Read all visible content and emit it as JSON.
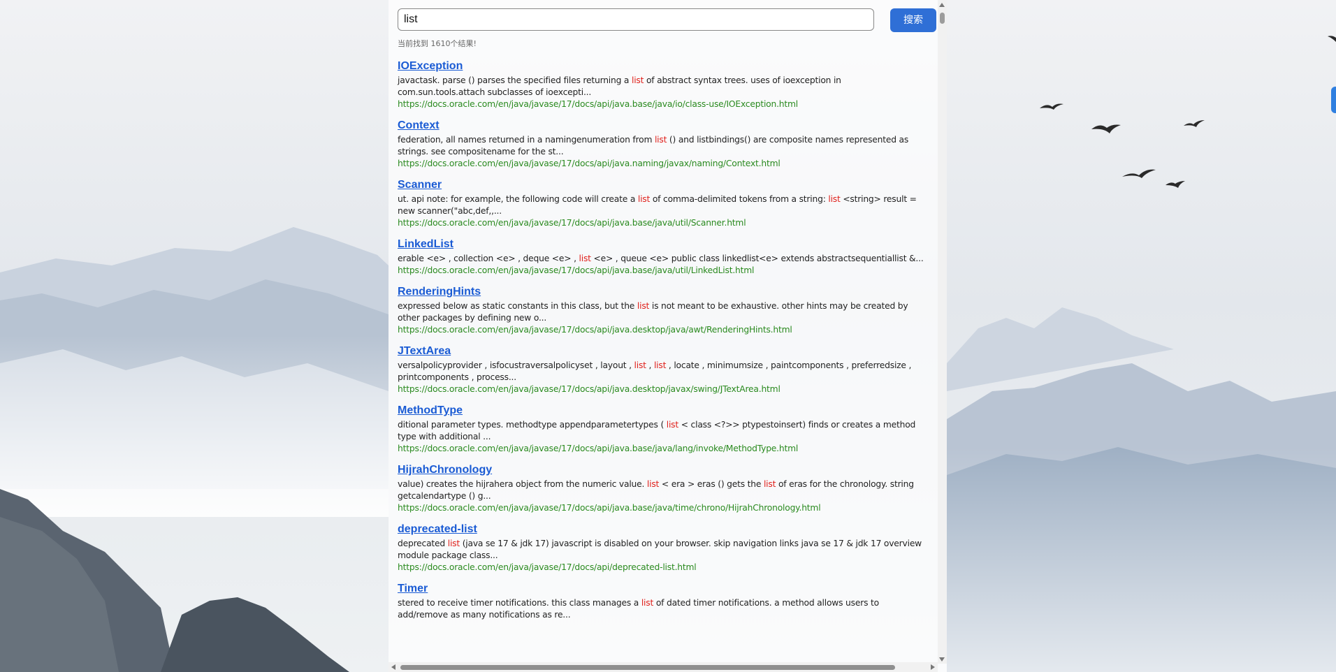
{
  "search": {
    "value": "list",
    "button_label": "搜索"
  },
  "result_count_text": "当前找到 1610个结果!",
  "results": [
    {
      "title": "IOException",
      "snippet_before": "javactask. parse () parses the specified files returning a ",
      "highlight": "list",
      "snippet_after": " of abstract syntax trees. uses of ioexception in com.sun.tools.attach subclasses of ioexcepti...",
      "url": "https://docs.oracle.com/en/java/javase/17/docs/api/java.base/java/io/class-use/IOException.html"
    },
    {
      "title": "Context",
      "snippet_before": "federation, all names returned in a namingenumeration from ",
      "highlight": "list",
      "snippet_after": " () and listbindings() are composite names represented as strings. see compositename for the st...",
      "url": "https://docs.oracle.com/en/java/javase/17/docs/api/java.naming/javax/naming/Context.html"
    },
    {
      "title": "Scanner",
      "snippet_before": "ut. api note: for example, the following code will create a ",
      "highlight": "list",
      "snippet_mid": " of comma-delimited tokens from a string: ",
      "highlight2": "list",
      "snippet_after": " <string> result = new scanner(\"abc,def,,...",
      "url": "https://docs.oracle.com/en/java/javase/17/docs/api/java.base/java/util/Scanner.html"
    },
    {
      "title": "LinkedList",
      "snippet_before": "erable <e> , collection <e> , deque <e> , ",
      "highlight": "list",
      "snippet_after": " <e> , queue <e> public class linkedlist<e> extends abstractsequentiallist &...",
      "url": "https://docs.oracle.com/en/java/javase/17/docs/api/java.base/java/util/LinkedList.html"
    },
    {
      "title": "RenderingHints",
      "snippet_before": "expressed below as static constants in this class, but the ",
      "highlight": "list",
      "snippet_after": " is not meant to be exhaustive. other hints may be created by other packages by defining new o...",
      "url": "https://docs.oracle.com/en/java/javase/17/docs/api/java.desktop/java/awt/RenderingHints.html"
    },
    {
      "title": "JTextArea",
      "snippet_before": "versalpolicyprovider , isfocustraversalpolicyset , layout , ",
      "highlight": "list",
      "snippet_mid": " , ",
      "highlight2": "list",
      "snippet_after": " , locate , minimumsize , paintcomponents , preferredsize , printcomponents , process...",
      "url": "https://docs.oracle.com/en/java/javase/17/docs/api/java.desktop/javax/swing/JTextArea.html"
    },
    {
      "title": "MethodType",
      "snippet_before": "ditional parameter types. methodtype appendparametertypes ( ",
      "highlight": "list",
      "snippet_after": " < class <?>> ptypestoinsert) finds or creates a method type with additional ...",
      "url": "https://docs.oracle.com/en/java/javase/17/docs/api/java.base/java/lang/invoke/MethodType.html"
    },
    {
      "title": "HijrahChronology",
      "snippet_before": "value) creates the hijrahera object from the numeric value. ",
      "highlight": "list",
      "snippet_mid": " < era > eras () gets the ",
      "highlight2": "list",
      "snippet_after": " of eras for the chronology. string getcalendartype () g...",
      "url": "https://docs.oracle.com/en/java/javase/17/docs/api/java.base/java/time/chrono/HijrahChronology.html"
    },
    {
      "title": "deprecated-list",
      "snippet_before": "deprecated ",
      "highlight": "list",
      "snippet_after": " (java se 17 & jdk 17) javascript is disabled on your browser. skip navigation links java se 17 & jdk 17 overview module package class...",
      "url": "https://docs.oracle.com/en/java/javase/17/docs/api/deprecated-list.html"
    },
    {
      "title": "Timer",
      "snippet_before": "stered to receive timer notifications. this class manages a ",
      "highlight": "list",
      "snippet_after": " of dated timer notifications. a method allows users to add/remove as many notifications as re...",
      "url": ""
    }
  ],
  "icons": {
    "scroll_up": "scroll-up-arrow-icon",
    "scroll_down": "scroll-down-arrow-icon",
    "scroll_left": "scroll-left-arrow-icon",
    "scroll_right": "scroll-right-arrow-icon"
  },
  "colors": {
    "link": "#1a5bd4",
    "highlight": "#e0201b",
    "url": "#2a8a1f",
    "button": "#2f6fd6"
  }
}
